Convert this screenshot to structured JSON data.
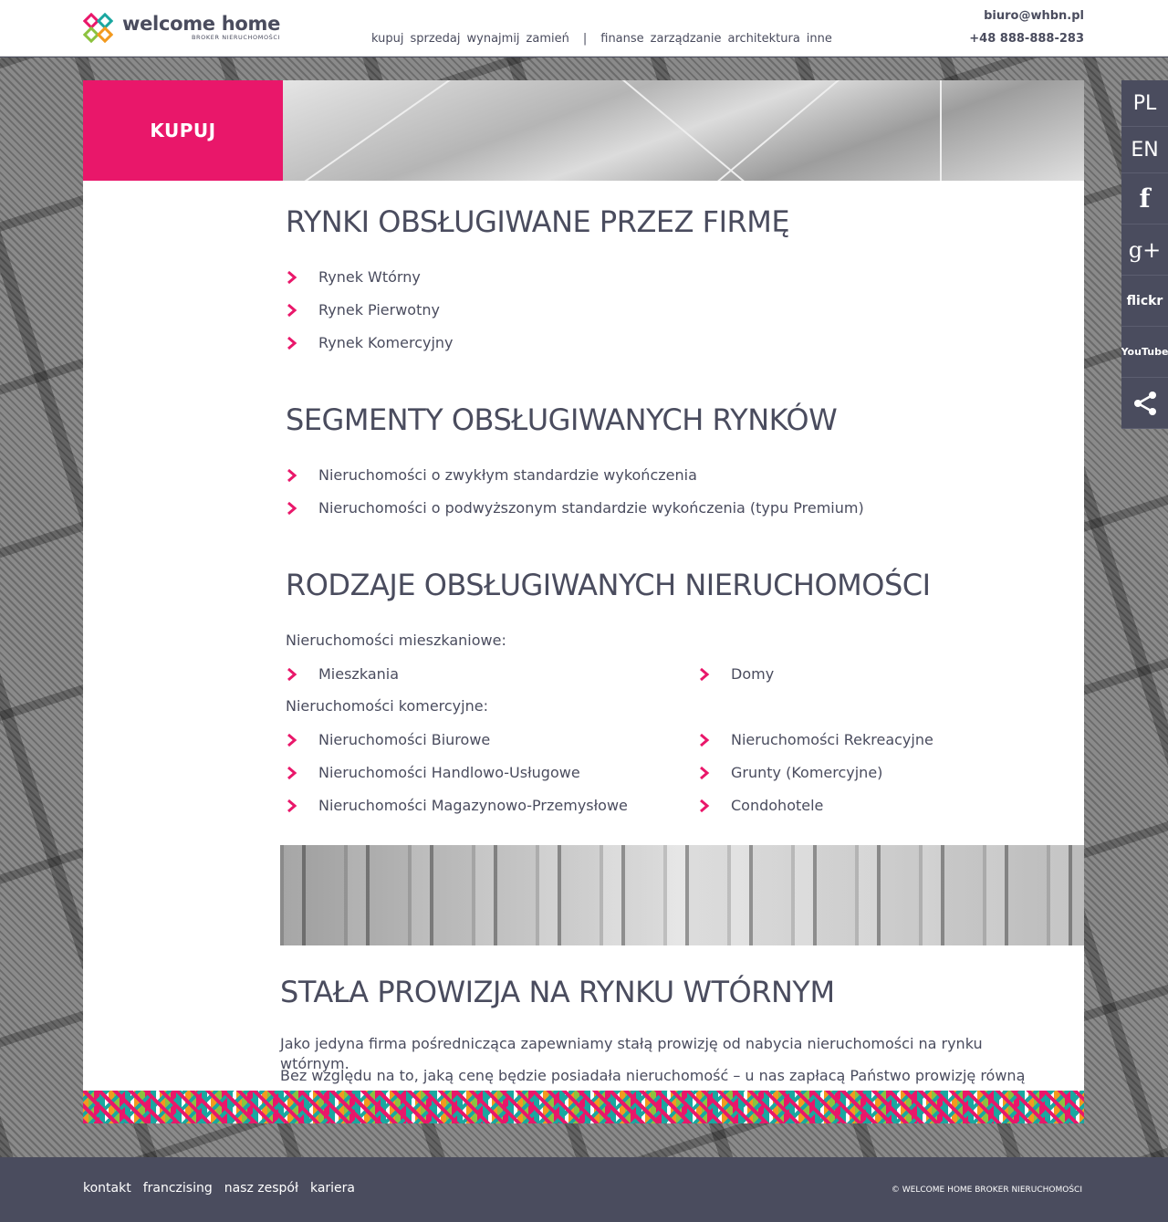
{
  "header": {
    "logo_name": "welcome home",
    "logo_sub": "BROKER NIERUCHOMOŚCI",
    "nav_primary": [
      "kupuj",
      "sprzedaj",
      "wynajmij",
      "zamień"
    ],
    "nav_separator": "|",
    "nav_secondary": [
      "finanse",
      "zarządzanie",
      "architektura",
      "inne"
    ],
    "email": "biuro@whbn.pl",
    "phone": "+48 888-888-283"
  },
  "hero": {
    "title": "KUPUJ"
  },
  "sections": {
    "markets": {
      "heading": "RYNKI OBSŁUGIWANE PRZEZ FIRMĘ",
      "items": [
        "Rynek Wtórny",
        "Rynek Pierwotny",
        "Rynek Komercyjny"
      ]
    },
    "segments": {
      "heading": "SEGMENTY OBSŁUGIWANYCH RYNKÓW",
      "items": [
        "Nieruchomości o zwykłym standardzie wykończenia",
        "Nieruchomości o podwyższonym standardzie wykończenia (typu Premium)"
      ]
    },
    "types": {
      "heading": "RODZAJE OBSŁUGIWANYCH NIERUCHOMOŚCI",
      "residential_label": "Nieruchomości mieszkaniowe:",
      "residential_left": [
        "Mieszkania"
      ],
      "residential_right": [
        "Domy"
      ],
      "commercial_label": "Nieruchomości komercyjne:",
      "commercial_left": [
        "Nieruchomości Biurowe",
        "Nieruchomości Handlowo-Usługowe",
        "Nieruchomości Magazynowo-Przemysłowe"
      ],
      "commercial_right": [
        "Nieruchomości Rekreacyjne",
        "Grunty (Komercyjne)",
        "Condohotele"
      ]
    },
    "commission": {
      "heading": "STAŁA PROWIZJA NA RYNKU WTÓRNYM",
      "p1": "Jako jedyna firma pośrednicząca zapewniamy stałą prowizję od nabycia nieruchomości na rynku wtórnym.",
      "p2": "Bez względu na to, jaką cenę będzie posiadała nieruchomość – u nas zapłacą Państwo prowizję równą"
    }
  },
  "sidebar": {
    "lang_pl": "PL",
    "lang_en": "EN",
    "facebook": "f",
    "gplus": "g+",
    "flickr": "flickr",
    "youtube": "YouTube"
  },
  "footer": {
    "links": [
      "kontakt",
      "franczising",
      "nasz zespół",
      "kariera"
    ],
    "copyright": "© WELCOME HOME BROKER NIERUCHOMOŚCI"
  },
  "colors": {
    "accent": "#e9176a",
    "dark": "#4a4c5e"
  }
}
